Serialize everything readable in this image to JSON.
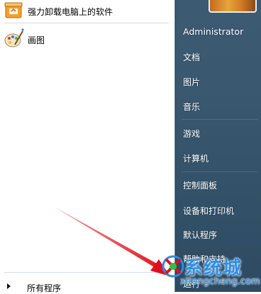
{
  "left": {
    "programs": [
      {
        "label": "强力卸载电脑上的软件",
        "icon": "uninstall-box-icon"
      },
      {
        "label": "画图",
        "icon": "paint-palette-icon"
      }
    ],
    "all_programs_label": "所有程序"
  },
  "right": {
    "user_picture": "user-picture-icon",
    "items": [
      {
        "label": "Administrator"
      },
      {
        "label": "文档"
      },
      {
        "label": "图片"
      },
      {
        "label": "音乐"
      },
      {
        "label": "游戏"
      },
      {
        "label": "计算机"
      },
      {
        "label": "控制面板"
      },
      {
        "label": "设备和打印机"
      },
      {
        "label": "默认程序"
      },
      {
        "label": "帮助和支持"
      },
      {
        "label": "运行"
      }
    ]
  },
  "watermark": {
    "brand": "系统城",
    "site": "xitongcheng.com"
  },
  "colors": {
    "right_panel": "#3a5870",
    "arrow": "#e0101a",
    "watermark": "#2a8ee6"
  }
}
